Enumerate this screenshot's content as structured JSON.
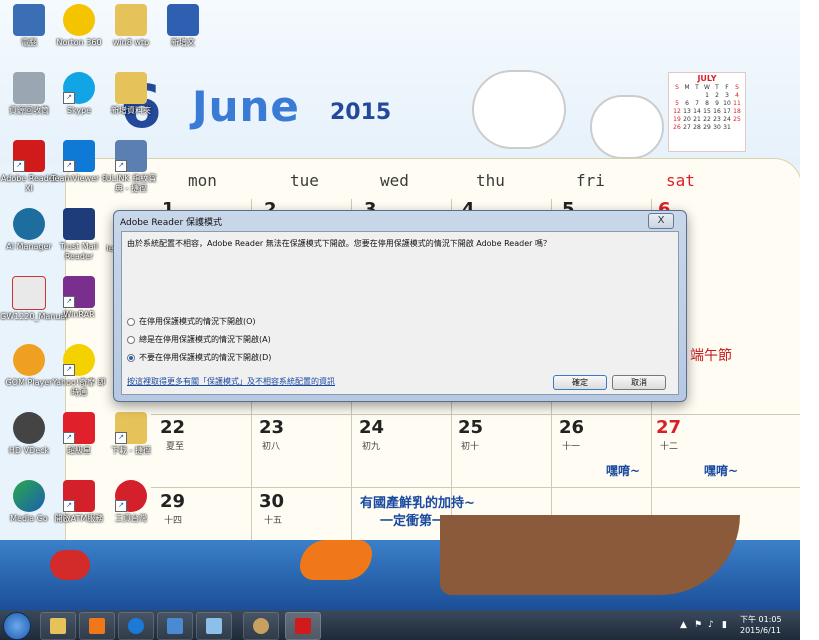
{
  "desktop_icons": [
    {
      "label": "電腦"
    },
    {
      "label": "Norton 360"
    },
    {
      "label": "win8 wtp"
    },
    {
      "label": "新增文"
    },
    {
      "label": "資源回收筒"
    },
    {
      "label": "Skype"
    },
    {
      "label": "新增資料夾"
    },
    {
      "label": "Adobe Reader XI"
    },
    {
      "label": "TeamViewer 8"
    },
    {
      "label": "ULINK 指紋寶典 - 捷徑"
    },
    {
      "label": "AI Manager"
    },
    {
      "label": "Trust Mail Reader"
    },
    {
      "label": "le"
    },
    {
      "label": "GW1220_Manual"
    },
    {
      "label": "WinRAR"
    },
    {
      "label": "GOM Player"
    },
    {
      "label": "Yahoo!奇摩 即時通"
    },
    {
      "label": "HD VDeck"
    },
    {
      "label": "超級星"
    },
    {
      "label": "下載 - 捷徑"
    },
    {
      "label": "Media Go"
    },
    {
      "label": "開啟ATM服務"
    },
    {
      "label": "工資台灣"
    }
  ],
  "calendar": {
    "month": "June",
    "year": "2015",
    "big_number": "6",
    "weekdays": [
      "mon",
      "tue",
      "wed",
      "thu",
      "fri",
      "sat"
    ],
    "row1_dates": [
      "1",
      "2",
      "3",
      "4",
      "5",
      "6"
    ],
    "row4": [
      {
        "date": "22",
        "sub": "夏至"
      },
      {
        "date": "23",
        "sub": "初八"
      },
      {
        "date": "24",
        "sub": "初九"
      },
      {
        "date": "25",
        "sub": "初十"
      },
      {
        "date": "26",
        "sub": "十一"
      },
      {
        "date": "27",
        "sub": "十二"
      }
    ],
    "row5": [
      {
        "date": "29",
        "sub": "十四"
      },
      {
        "date": "30",
        "sub": "十五"
      }
    ],
    "holiday_note": "端午節",
    "slogan_line1": "有國產鮮乳的加持~",
    "slogan_line2": "一定衝第一!!!",
    "bubble_left": "嘿唷~",
    "bubble_right": "嘿唷~"
  },
  "mini_calendar": {
    "title": "JULY",
    "head": [
      "S",
      "M",
      "T",
      "W",
      "T",
      "F",
      "S"
    ],
    "rows": [
      [
        "",
        "",
        "",
        "1",
        "2",
        "3",
        "4"
      ],
      [
        "5",
        "6",
        "7",
        "8",
        "9",
        "10",
        "11"
      ],
      [
        "12",
        "13",
        "14",
        "15",
        "16",
        "17",
        "18"
      ],
      [
        "19",
        "20",
        "21",
        "22",
        "23",
        "24",
        "25"
      ],
      [
        "26",
        "27",
        "28",
        "29",
        "30",
        "31",
        ""
      ]
    ]
  },
  "dialog": {
    "title": "Adobe Reader 保護模式",
    "close_label": "X",
    "message": "由於系統配置不相容，Adobe Reader 無法在保護模式下開啟。您要在停用保護模式的情況下開啟 Adobe Reader 嗎？",
    "options": [
      "在停用保護模式的情況下開啟(O)",
      "總是在停用保護模式的情況下開啟(A)",
      "不要在停用保護模式的情況下開啟(D)"
    ],
    "selected_option": 2,
    "link": "按這裡取得更多有關「保護模式」及不相容系統配置的資訊",
    "ok_label": "確定",
    "cancel_label": "取消"
  },
  "taskbar": {
    "clock_time": "下午 01:05",
    "clock_date": "2015/6/11",
    "items": [
      "explorer",
      "media-player",
      "internet-explorer",
      "remote-desktop",
      "notes",
      "paint",
      "adobe-reader"
    ]
  },
  "colors": {
    "accent_blue": "#3a7bd5",
    "holiday_red": "#d9202a",
    "taskbar": "#1e2a38"
  }
}
